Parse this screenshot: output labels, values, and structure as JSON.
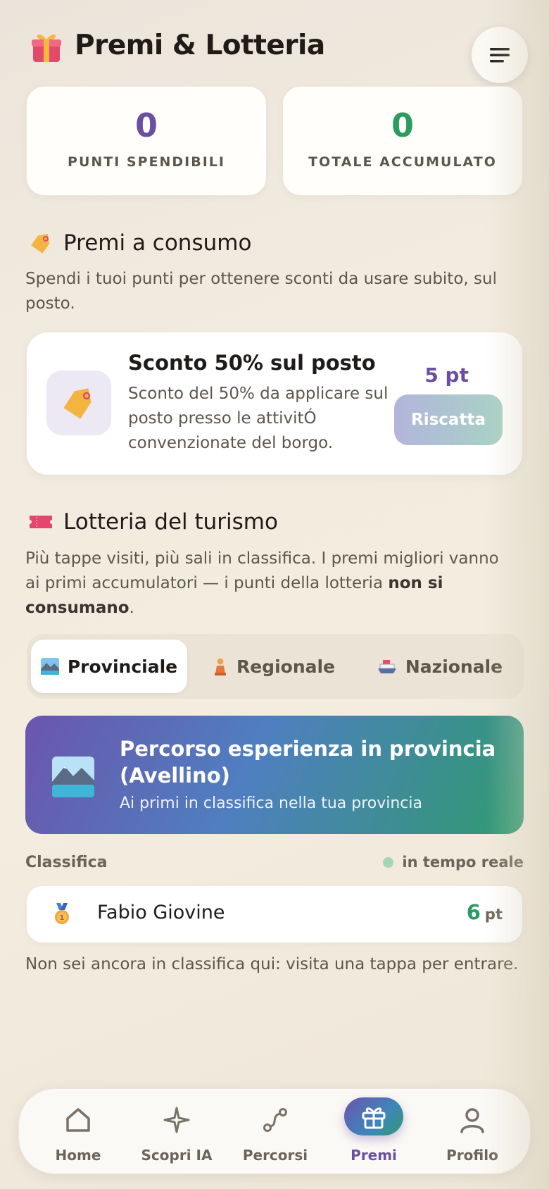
{
  "header": {
    "title": "Premi & Lotteria",
    "gift_icon": "gift-icon",
    "menu_icon": "hamburger-menu-icon"
  },
  "stats": [
    {
      "value": "0",
      "label": "PUNTI SPENDIBILI",
      "color": "#6a4fa1"
    },
    {
      "value": "0",
      "label": "TOTALE ACCUMULATO",
      "color": "#2b9b62"
    }
  ],
  "consumables": {
    "title": "Premi a consumo",
    "icon": "tag-icon",
    "description": "Spendi i tuoi punti per ottenere sconti da usare subito, sul posto.",
    "reward": {
      "title": "Sconto 50% sul posto",
      "description": "Sconto del 50% da applicare sul posto presso le attivitÓ convenzionate del borgo.",
      "points": "5 pt",
      "button": "Riscatta"
    }
  },
  "lottery": {
    "title": "Lotteria del turismo",
    "icon": "ticket-icon",
    "description_pre": "Più tappe visiti, più sali in classifica. I premi migliori vanno ai primi accumulatori — i punti della lotteria ",
    "description_bold": "non si consumano",
    "description_post": ".",
    "tabs": [
      {
        "label": "Provinciale",
        "icon": "landscape-icon",
        "active": true
      },
      {
        "label": "Regionale",
        "icon": "trophy-figure-icon",
        "active": false
      },
      {
        "label": "Nazionale",
        "icon": "ship-icon",
        "active": false
      }
    ],
    "banner": {
      "title": "Percorso esperienza in provincia (Avellino)",
      "subtitle": "Ai primi in classifica nella tua provincia",
      "icon": "landscape-icon"
    }
  },
  "ranking": {
    "title": "Classifica",
    "realtime": "in tempo reale",
    "rows": [
      {
        "name": "Fabio Giovine",
        "points": "6",
        "unit": "pt",
        "medal": "first-place-medal-icon"
      }
    ],
    "not_ranked": "Non sei ancora in classifica qui: visita una tappa per entrare."
  },
  "nav": [
    {
      "label": "Home",
      "icon": "home-icon",
      "active": false
    },
    {
      "label": "Scopri IA",
      "icon": "sparkle-icon",
      "active": false
    },
    {
      "label": "Percorsi",
      "icon": "route-icon",
      "active": false
    },
    {
      "label": "Premi",
      "icon": "gift-icon",
      "active": true
    },
    {
      "label": "Profilo",
      "icon": "user-icon",
      "active": false
    }
  ]
}
